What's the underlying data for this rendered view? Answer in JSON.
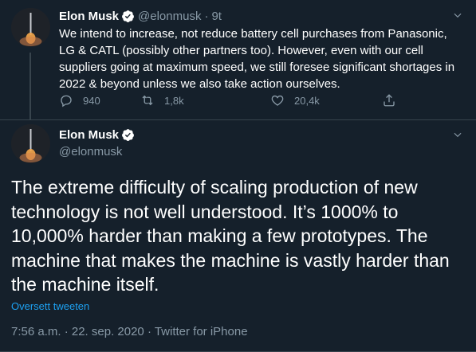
{
  "tweet1": {
    "author_name": "Elon Musk",
    "handle": "@elonmusk",
    "separator": "·",
    "time": "9t",
    "text": "We intend to increase, not reduce battery cell purchases from Panasonic, LG & CATL (possibly other partners too). However, even with our cell suppliers going at maximum speed, we still foresee significant shortages in 2022 & beyond unless we also take action ourselves.",
    "reply_count": "940",
    "retweet_count": "1,8k",
    "like_count": "20,4k"
  },
  "tweet2": {
    "author_name": "Elon Musk",
    "handle": "@elonmusk",
    "text": "The extreme difficulty of scaling production of new technology is not well understood. It’s 1000% to 10,000% harder than making a few prototypes. The machine that makes the machine is vastly harder than the machine itself.",
    "translate_label": "Oversett tweeten",
    "meta": "7:56 a.m. · 22. sep. 2020 · Twitter for iPhone"
  },
  "icons": {
    "verified": "verified-badge-icon",
    "reply": "comment-icon",
    "retweet": "retweet-icon",
    "like": "heart-icon",
    "share": "share-icon",
    "more": "chevron-down-icon"
  },
  "colors": {
    "background": "#15202b",
    "text_primary": "#ffffff",
    "text_secondary": "#8899a6",
    "link": "#1da1f2",
    "divider": "#38444d"
  }
}
